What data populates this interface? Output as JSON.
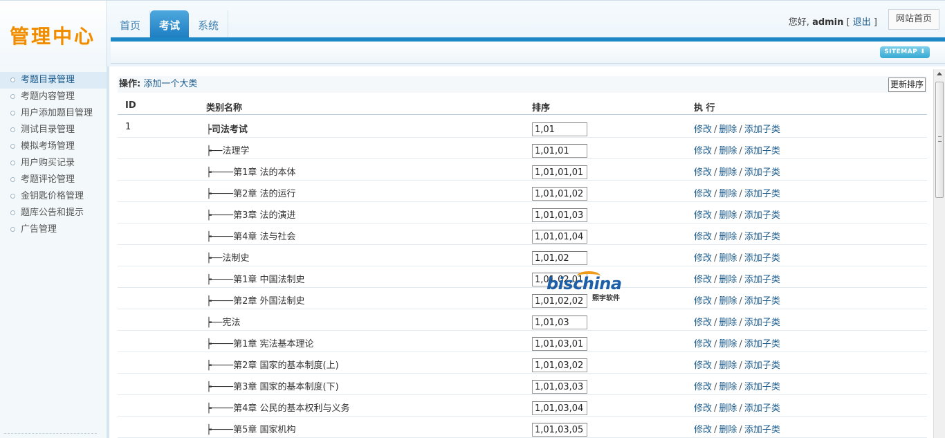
{
  "header": {
    "logo": "管理中心",
    "tabs": [
      {
        "label": "首页",
        "active": false
      },
      {
        "label": "考试",
        "active": true
      },
      {
        "label": "系统",
        "active": false
      }
    ],
    "greeting": "您好,",
    "username": "admin",
    "logout_open": "[",
    "logout": "退出",
    "logout_close": "]",
    "home_button": "网站首页",
    "sitemap": "SITEMAP ⬇"
  },
  "sidebar": {
    "items": [
      {
        "label": "考题目录管理",
        "active": true
      },
      {
        "label": "考题内容管理",
        "active": false
      },
      {
        "label": "用户添加题目管理",
        "active": false
      },
      {
        "label": "测试目录管理",
        "active": false
      },
      {
        "label": "模拟考场管理",
        "active": false
      },
      {
        "label": "用户购买记录",
        "active": false
      },
      {
        "label": "考题评论管理",
        "active": false
      },
      {
        "label": "金钥匙价格管理",
        "active": false
      },
      {
        "label": "题库公告和提示",
        "active": false
      },
      {
        "label": "广告管理",
        "active": false
      }
    ]
  },
  "ops": {
    "label": "操作:",
    "add_link": "添加一个大类",
    "update_button": "更新排序"
  },
  "table": {
    "headers": {
      "id": "ID",
      "name": "类别名称",
      "order": "排序",
      "actions": "执 行"
    },
    "actions": {
      "edit": "修改",
      "delete": "删除",
      "add_child": "添加子类",
      "sep": "/"
    },
    "rows": [
      {
        "id": "1",
        "name": "┝司法考试",
        "order": "1,01",
        "bold": true
      },
      {
        "id": "",
        "name": "┝──法理学",
        "order": "1,01,01",
        "bold": false
      },
      {
        "id": "",
        "name": "┝────第1章 法的本体",
        "order": "1,01,01,01",
        "bold": false
      },
      {
        "id": "",
        "name": "┝────第2章 法的运行",
        "order": "1,01,01,02",
        "bold": false
      },
      {
        "id": "",
        "name": "┝────第3章 法的演进",
        "order": "1,01,01,03",
        "bold": false
      },
      {
        "id": "",
        "name": "┝────第4章 法与社会",
        "order": "1,01,01,04",
        "bold": false
      },
      {
        "id": "",
        "name": "┝──法制史",
        "order": "1,01,02",
        "bold": false
      },
      {
        "id": "",
        "name": "┝────第1章 中国法制史",
        "order": "1,01,02,01",
        "bold": false
      },
      {
        "id": "",
        "name": "┝────第2章 外国法制史",
        "order": "1,01,02,02",
        "bold": false
      },
      {
        "id": "",
        "name": "┝──宪法",
        "order": "1,01,03",
        "bold": false
      },
      {
        "id": "",
        "name": "┝────第1章 宪法基本理论",
        "order": "1,01,03,01",
        "bold": false
      },
      {
        "id": "",
        "name": "┝────第2章 国家的基本制度(上)",
        "order": "1,01,03,02",
        "bold": false
      },
      {
        "id": "",
        "name": "┝────第3章 国家的基本制度(下)",
        "order": "1,01,03,03",
        "bold": false
      },
      {
        "id": "",
        "name": "┝────第4章 公民的基本权利与义务",
        "order": "1,01,03,04",
        "bold": false
      },
      {
        "id": "",
        "name": "┝────第5章 国家机构",
        "order": "1,01,03,05",
        "bold": false
      }
    ]
  },
  "watermark": {
    "text": "bischina",
    "sub": "熙宇软件"
  },
  "colors": {
    "accent": "#1e88c7",
    "link": "#1a5a8c",
    "logo": "#f08c00"
  }
}
